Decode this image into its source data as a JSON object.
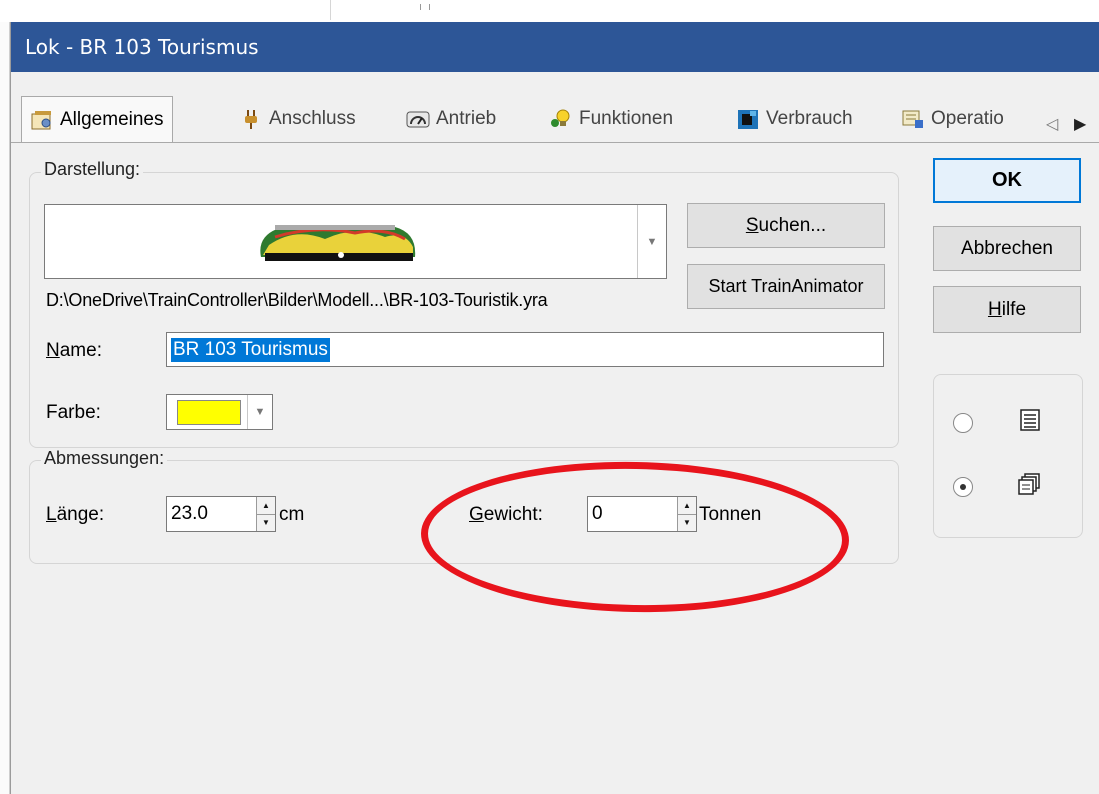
{
  "window": {
    "title": "Lok - BR 103 Tourismus"
  },
  "tabs": [
    {
      "label": "Allgemeines",
      "icon": "settings-sheet-icon",
      "active": true
    },
    {
      "label": "Anschluss",
      "icon": "plug-icon",
      "active": false
    },
    {
      "label": "Antrieb",
      "icon": "gauge-icon",
      "active": false
    },
    {
      "label": "Funktionen",
      "icon": "lightbulb-icon",
      "active": false
    },
    {
      "label": "Verbrauch",
      "icon": "fuel-icon",
      "active": false
    },
    {
      "label": "Operatio",
      "icon": "operations-icon",
      "active": false
    }
  ],
  "tab_scroll": {
    "left": "◁",
    "right": "▶"
  },
  "darstellung": {
    "group_label": "Darstellung:",
    "image_icon": "locomotive-image",
    "path": "D:\\OneDrive\\TrainController\\Bilder\\Modell...\\BR-103-Touristik.yra",
    "search_button": "Suchen...",
    "search_button_rest": "uchen...",
    "search_button_mnemonic": "S",
    "animator_button": "Start TrainAnimator",
    "name_label": "Name:",
    "name_label_mnemonic": "N",
    "name_label_rest": "ame:",
    "name_value": "BR 103 Tourismus",
    "color_label": "Farbe:",
    "color_value": "#ffff00"
  },
  "abmessungen": {
    "group_label": "Abmessungen:",
    "length_label": "Länge:",
    "length_label_mnemonic": "L",
    "length_label_rest": "änge:",
    "length_value": "23.0",
    "length_unit": "cm",
    "weight_label": "Gewicht:",
    "weight_label_mnemonic": "G",
    "weight_label_rest": "ewicht:",
    "weight_value": "0",
    "weight_unit": "Tonnen"
  },
  "buttons": {
    "ok": "OK",
    "cancel": "Abbrechen",
    "help": "Hilfe",
    "help_mnemonic": "H",
    "help_rest": "ilfe"
  },
  "view_mode": {
    "options": [
      {
        "icon": "list-view-icon",
        "selected": false
      },
      {
        "icon": "cards-view-icon",
        "selected": true
      }
    ]
  },
  "annotation": {
    "color": "#e8141c",
    "shape": "ellipse"
  },
  "colors": {
    "titlebar": "#2d5697",
    "selection": "#0078d7",
    "dialog_bg": "#f0f0f0"
  }
}
